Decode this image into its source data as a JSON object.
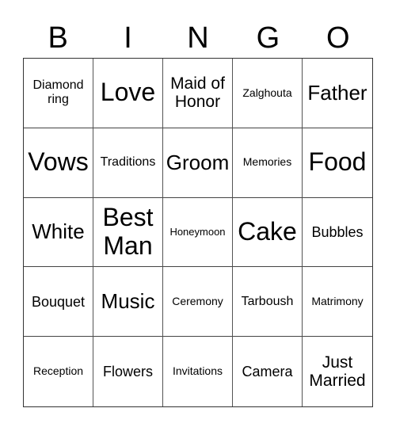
{
  "header": [
    "B",
    "I",
    "N",
    "G",
    "O"
  ],
  "cells": [
    [
      "Diamond ring",
      "Love",
      "Maid of Honor",
      "Zalghouta",
      "Father"
    ],
    [
      "Vows",
      "Traditions",
      "Groom",
      "Memories",
      "Food"
    ],
    [
      "White",
      "Best Man",
      "Honeymoon",
      "Cake",
      "Bubbles"
    ],
    [
      "Bouquet",
      "Music",
      "Ceremony",
      "Tarboush",
      "Matrimony"
    ],
    [
      "Reception",
      "Flowers",
      "Invitations",
      "Camera",
      "Just Married"
    ]
  ]
}
